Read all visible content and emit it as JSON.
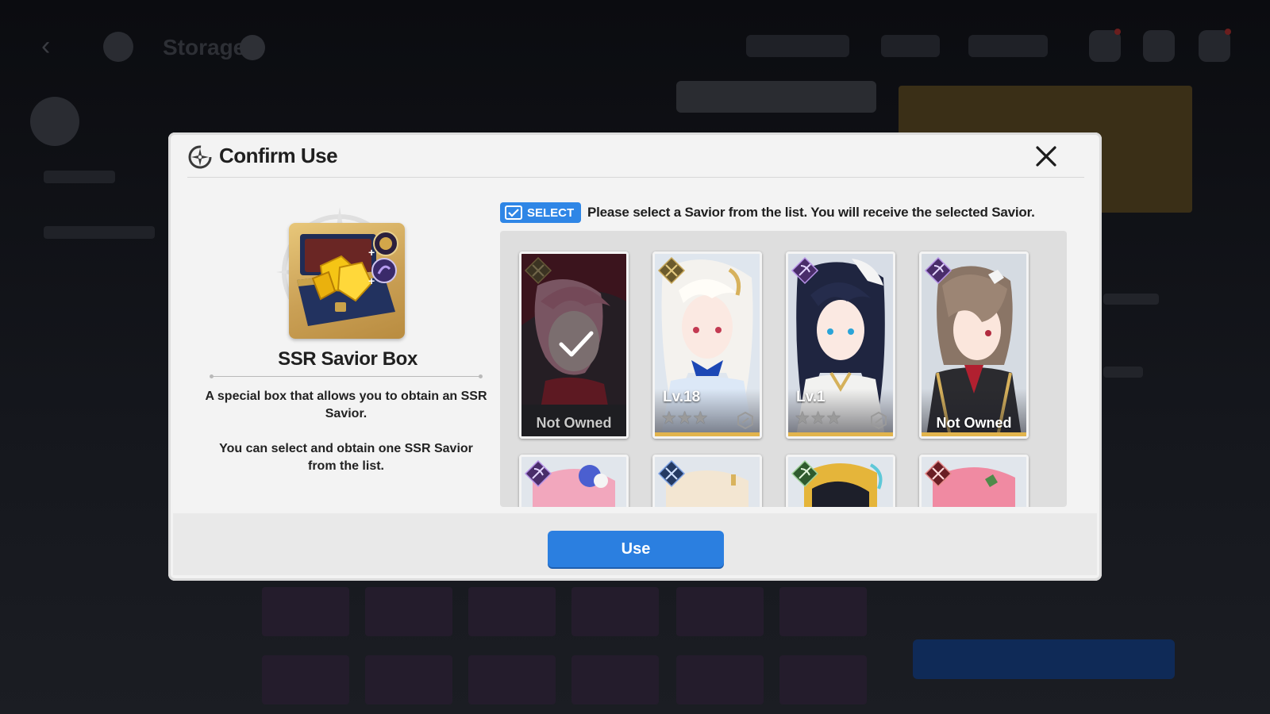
{
  "background": {
    "screen_title": "Storage"
  },
  "modal": {
    "title": "Confirm Use",
    "close_icon": "close-icon",
    "item": {
      "name": "SSR Savior Box",
      "description_1": "A special box that allows you to obtain an SSR Savior.",
      "description_2": "You can select and obtain one SSR Savior from the list."
    },
    "select_badge": "SELECT",
    "instruction": "Please select a Savior from the list. You will receive the selected Savior.",
    "saviors": [
      {
        "status": "Not Owned",
        "level": "",
        "stars": "",
        "selected": true,
        "owned": false
      },
      {
        "status": "",
        "level": "Lv.18",
        "stars": "★★★",
        "selected": false,
        "owned": true
      },
      {
        "status": "",
        "level": "Lv.1",
        "stars": "★★★",
        "selected": false,
        "owned": true
      },
      {
        "status": "Not Owned",
        "level": "",
        "stars": "",
        "selected": false,
        "owned": false
      }
    ],
    "use_button": "Use"
  },
  "colors": {
    "accent_blue": "#2b7fe0",
    "card_gold": "#e2b44d",
    "modal_bg": "#f3f3f3"
  }
}
